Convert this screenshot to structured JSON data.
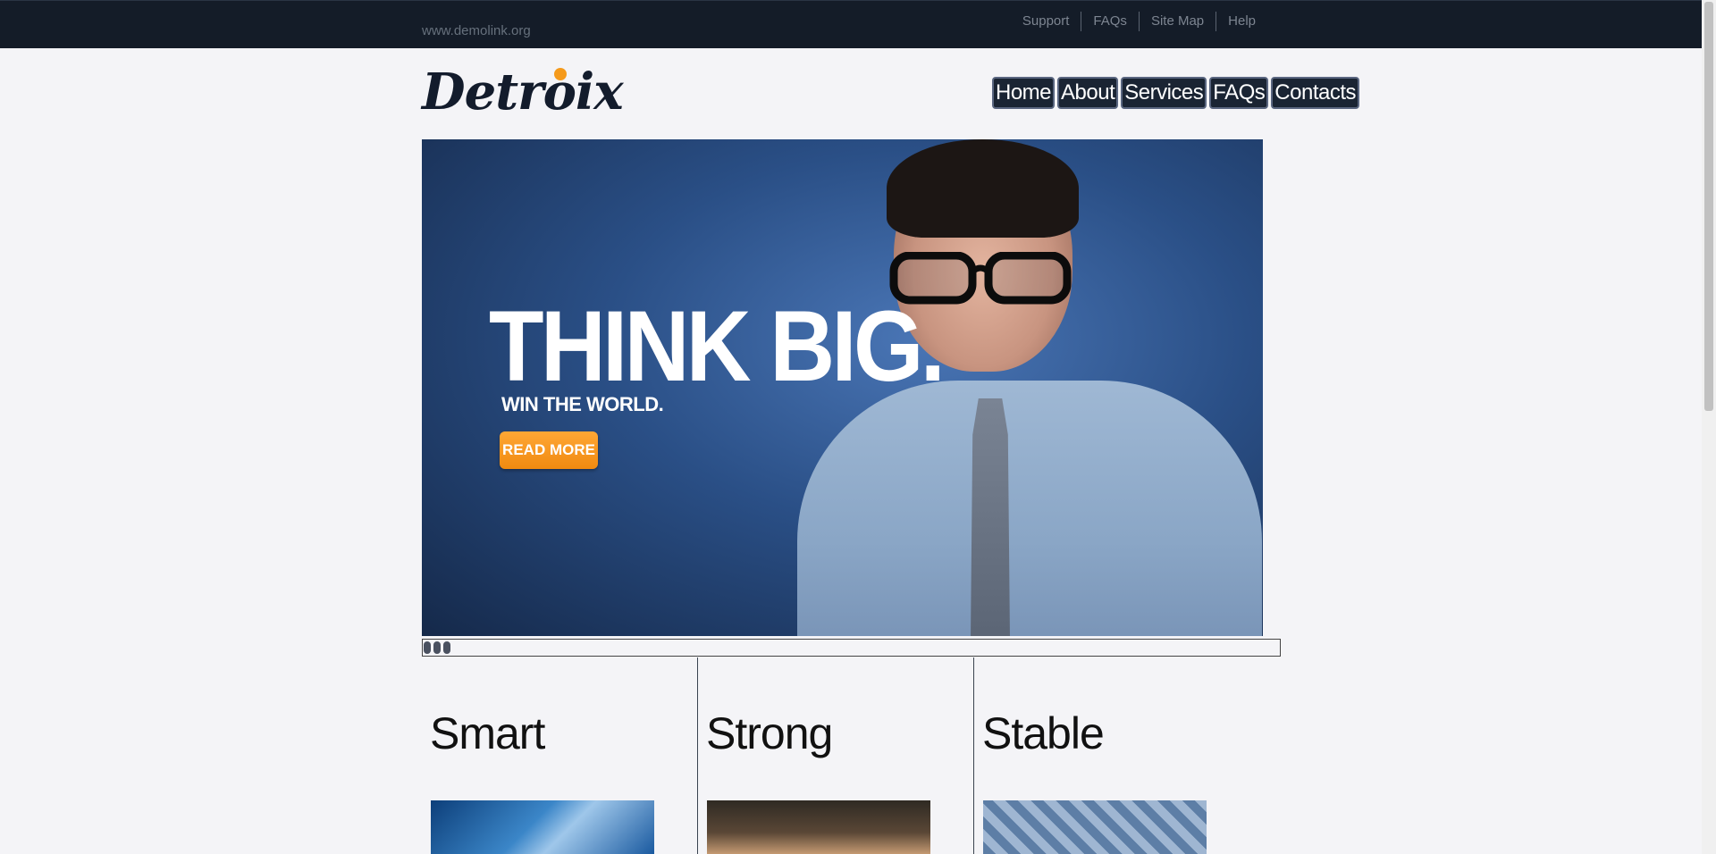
{
  "topbar": {
    "site_url": "www.demolink.org",
    "links": [
      "Support",
      "FAQs",
      "Site Map",
      "Help"
    ]
  },
  "header": {
    "logo_text": "Detroix",
    "nav": [
      "Home",
      "About",
      "Services",
      "FAQs",
      "Contacts"
    ]
  },
  "slider": {
    "headline": "THINK BIG.",
    "subline": "WIN THE WORLD.",
    "button_label": "READ MORE",
    "pager_dots": 3
  },
  "features": [
    {
      "title": "Smart",
      "image": "puzzle-image"
    },
    {
      "title": "Strong",
      "image": "plant-image"
    },
    {
      "title": "Stable",
      "image": "maze-image"
    }
  ],
  "colors": {
    "topbar_bg": "#141c28",
    "accent": "#f59a1b",
    "nav_bg": "#1a2433",
    "slider_blue": "#2a4f86"
  }
}
